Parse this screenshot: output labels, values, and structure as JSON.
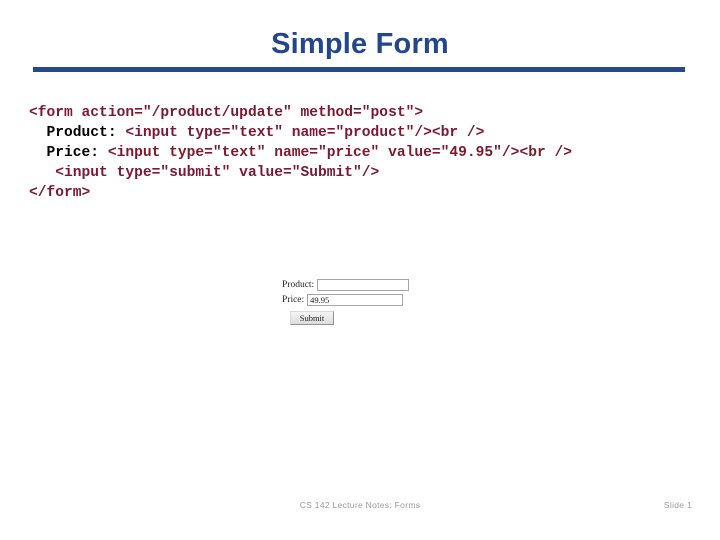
{
  "slide": {
    "title": "Simple Form",
    "accent_color": "#254a87",
    "code_color": "#7c1832",
    "background": "#ffffff"
  },
  "code": {
    "lines": [
      {
        "id": "line1",
        "segments": [
          {
            "text": "<form action=\"/product/update\" method=\"post\">",
            "kind": "tag"
          }
        ]
      },
      {
        "id": "line2",
        "segments": [
          {
            "text": "  Product: ",
            "kind": "plain"
          },
          {
            "text": "<input type=\"text\" name=\"product\"/><br />",
            "kind": "tag"
          }
        ]
      },
      {
        "id": "line3",
        "segments": [
          {
            "text": "  Price: ",
            "kind": "plain"
          },
          {
            "text": "<input type=\"text\" name=\"price\" value=\"49.95\"/><br />",
            "kind": "tag"
          }
        ]
      },
      {
        "id": "line4",
        "segments": [
          {
            "text": "   <input type=\"submit\" value=\"Submit\"/>",
            "kind": "tag"
          }
        ]
      },
      {
        "id": "line5",
        "segments": [
          {
            "text": "</form>",
            "kind": "tag"
          }
        ]
      }
    ]
  },
  "rendered_form": {
    "product_label": "Product:",
    "product_value": "",
    "price_label": "Price:",
    "price_value": "49.95",
    "submit_label": "Submit"
  },
  "footer": {
    "center": "CS 142 Lecture Notes: Forms",
    "right": "Slide 1"
  }
}
